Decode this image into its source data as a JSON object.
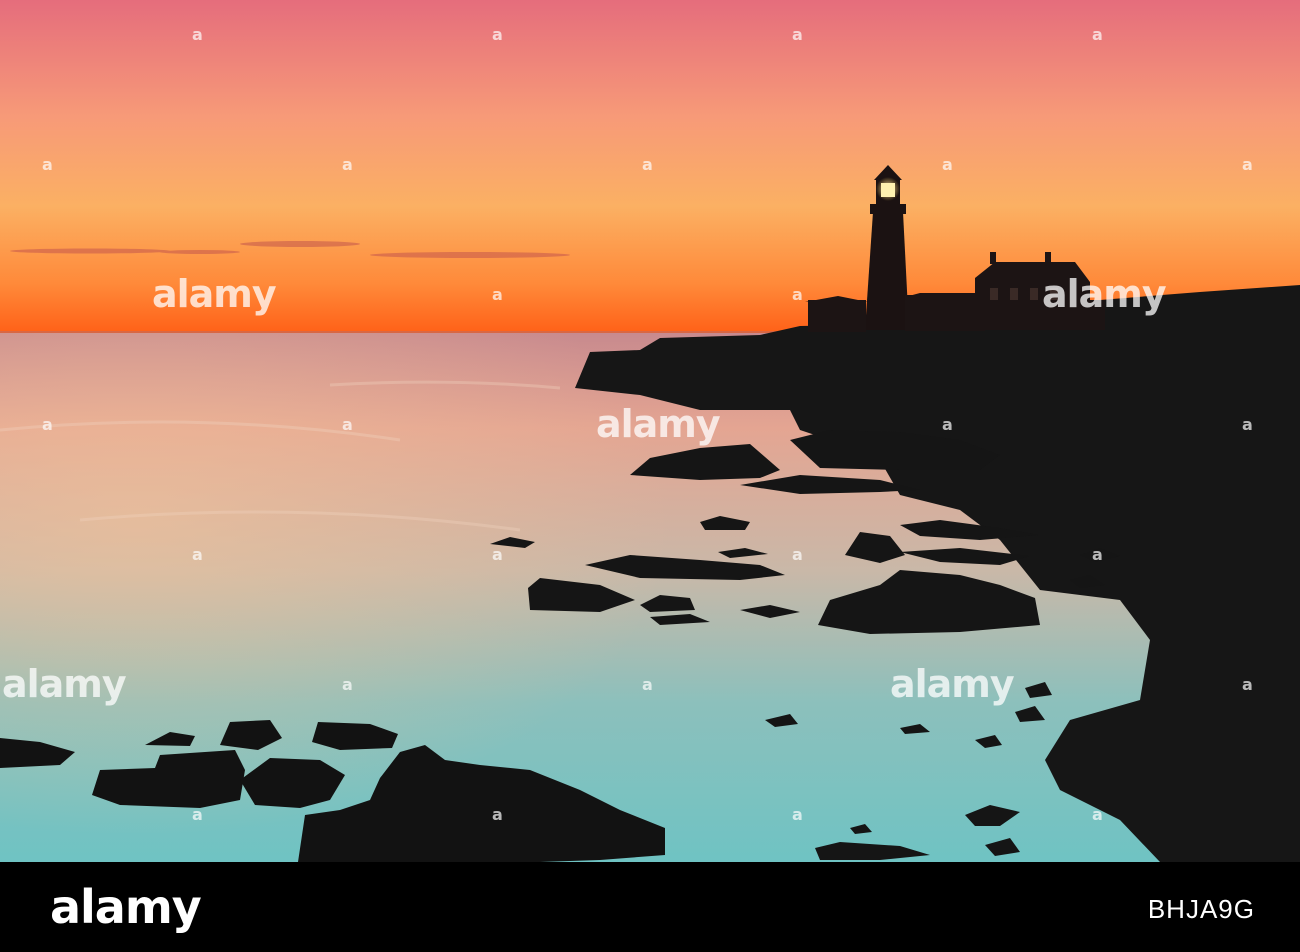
{
  "watermark": {
    "word": "alamy",
    "glyph": "a"
  },
  "footer": {
    "logo_text": "alamy",
    "image_code": "BHJA9G"
  },
  "colors": {
    "sky_top": "#e8707a",
    "sky_mid": "#f7a16a",
    "sky_horizon": "#ff6a1f",
    "sea_far": "#d98a80",
    "sea_near": "#79c8c5",
    "rock": "#141414",
    "footer_bg": "#000000"
  }
}
